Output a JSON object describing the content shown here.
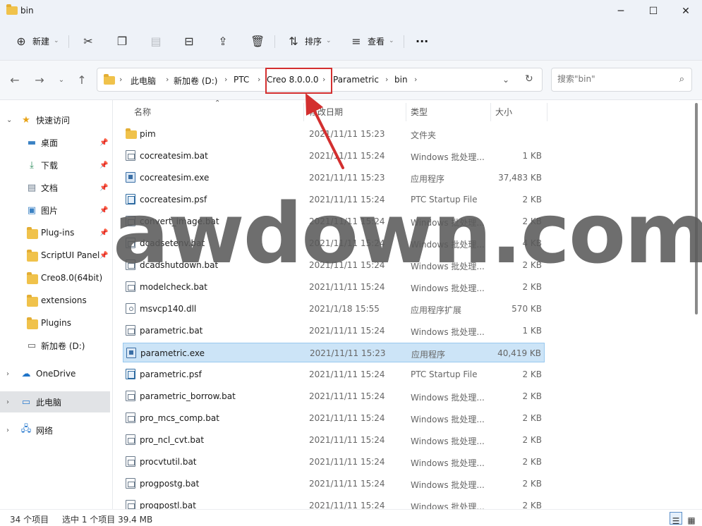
{
  "window": {
    "title": "bin",
    "minimize": "─",
    "maximize": "☐",
    "close": "✕"
  },
  "toolbar": {
    "new_label": "新建",
    "sort_label": "排序",
    "view_label": "查看",
    "more": "···"
  },
  "address": {
    "crumbs": [
      "此电脑",
      "新加卷 (D:)",
      "PTC",
      "Creo 8.0.0.0",
      "Parametric",
      "bin"
    ],
    "highlighted": "Creo 8.0.0.0"
  },
  "search": {
    "placeholder": "搜索\"bin\""
  },
  "sidebar": {
    "items": [
      {
        "label": "快速访问",
        "icon": "star-icon"
      },
      {
        "label": "桌面",
        "icon": "desktop-icon"
      },
      {
        "label": "下载",
        "icon": "download-icon"
      },
      {
        "label": "文档",
        "icon": "document-icon"
      },
      {
        "label": "图片",
        "icon": "pictures-icon"
      },
      {
        "label": "Plug-ins",
        "icon": "folder-icon"
      },
      {
        "label": "ScriptUI Panel",
        "icon": "folder-icon"
      },
      {
        "label": "Creo8.0(64bit)",
        "icon": "folder-icon"
      },
      {
        "label": "extensions",
        "icon": "folder-icon"
      },
      {
        "label": "Plugins",
        "icon": "folder-icon"
      },
      {
        "label": "新加卷 (D:)",
        "icon": "drive-icon"
      },
      {
        "label": "OneDrive",
        "icon": "cloud-icon"
      },
      {
        "label": "此电脑",
        "icon": "computer-icon"
      },
      {
        "label": "网络",
        "icon": "network-icon"
      }
    ]
  },
  "columns": {
    "name": "名称",
    "date": "修改日期",
    "type": "类型",
    "size": "大小"
  },
  "files": [
    {
      "name": "pim",
      "date": "2021/11/11 15:23",
      "type": "文件夹",
      "size": "",
      "icon": "folder"
    },
    {
      "name": "cocreatesim.bat",
      "date": "2021/11/11 15:24",
      "type": "Windows 批处理...",
      "size": "1 KB",
      "icon": "bat"
    },
    {
      "name": "cocreatesim.exe",
      "date": "2021/11/11 15:23",
      "type": "应用程序",
      "size": "37,483 KB",
      "icon": "exe"
    },
    {
      "name": "cocreatesim.psf",
      "date": "2021/11/11 15:24",
      "type": "PTC Startup File",
      "size": "2 KB",
      "icon": "psf"
    },
    {
      "name": "convert_image.bat",
      "date": "2021/11/11 15:24",
      "type": "Windows 批处理...",
      "size": "2 KB",
      "icon": "bat"
    },
    {
      "name": "dcadsetenv.bat",
      "date": "2021/11/11 15:24",
      "type": "Windows 批处理...",
      "size": "4 KB",
      "icon": "bat"
    },
    {
      "name": "dcadshutdown.bat",
      "date": "2021/11/11 15:24",
      "type": "Windows 批处理...",
      "size": "2 KB",
      "icon": "bat"
    },
    {
      "name": "modelcheck.bat",
      "date": "2021/11/11 15:24",
      "type": "Windows 批处理...",
      "size": "2 KB",
      "icon": "bat"
    },
    {
      "name": "msvcp140.dll",
      "date": "2021/1/18 15:55",
      "type": "应用程序扩展",
      "size": "570 KB",
      "icon": "dll"
    },
    {
      "name": "parametric.bat",
      "date": "2021/11/11 15:24",
      "type": "Windows 批处理...",
      "size": "1 KB",
      "icon": "bat"
    },
    {
      "name": "parametric.exe",
      "date": "2021/11/11 15:23",
      "type": "应用程序",
      "size": "40,419 KB",
      "icon": "exe",
      "selected": true
    },
    {
      "name": "parametric.psf",
      "date": "2021/11/11 15:24",
      "type": "PTC Startup File",
      "size": "2 KB",
      "icon": "psf"
    },
    {
      "name": "parametric_borrow.bat",
      "date": "2021/11/11 15:24",
      "type": "Windows 批处理...",
      "size": "2 KB",
      "icon": "bat"
    },
    {
      "name": "pro_mcs_comp.bat",
      "date": "2021/11/11 15:24",
      "type": "Windows 批处理...",
      "size": "2 KB",
      "icon": "bat"
    },
    {
      "name": "pro_ncl_cvt.bat",
      "date": "2021/11/11 15:24",
      "type": "Windows 批处理...",
      "size": "2 KB",
      "icon": "bat"
    },
    {
      "name": "procvtutil.bat",
      "date": "2021/11/11 15:24",
      "type": "Windows 批处理...",
      "size": "2 KB",
      "icon": "bat"
    },
    {
      "name": "progpostg.bat",
      "date": "2021/11/11 15:24",
      "type": "Windows 批处理...",
      "size": "2 KB",
      "icon": "bat"
    },
    {
      "name": "progpostl.bat",
      "date": "2021/11/11 15:24",
      "type": "Windows 批处理...",
      "size": "2 KB",
      "icon": "bat"
    }
  ],
  "status": {
    "count": "34 个项目",
    "selection": "选中 1 个项目  39.4 MB"
  },
  "watermark": "awdown.com",
  "colors": {
    "accent": "#cce4f7",
    "highlight_box": "#d32f2f",
    "folder": "#f0c24b"
  }
}
